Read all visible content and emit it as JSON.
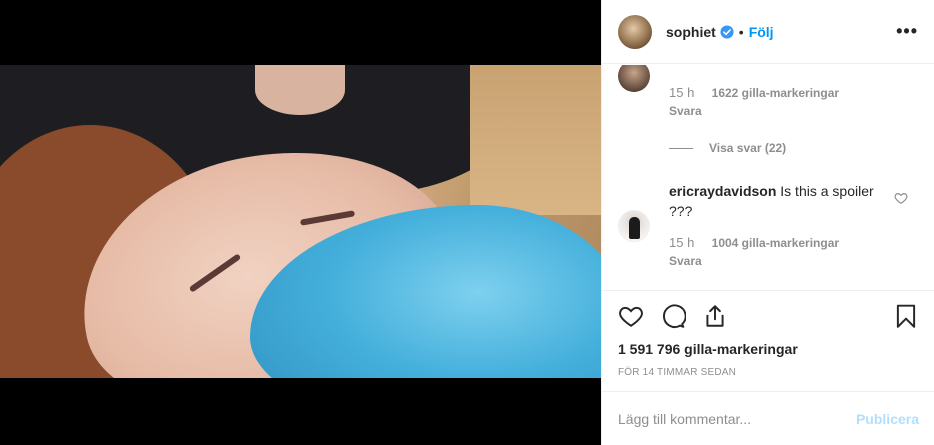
{
  "post": {
    "username": "sophiet",
    "follow_label": "Följ",
    "separator": "•",
    "more_label": "•••",
    "likes": "1 591 796 gilla-markeringar",
    "time_ago": "FÖR 14 TIMMAR SEDAN"
  },
  "comments": {
    "first": {
      "time": "15 h",
      "likes": "1622 gilla-markeringar",
      "reply": "Svara"
    },
    "view_replies": "Visa svar (22)",
    "second": {
      "username": "ericraydavidson",
      "text": "Is this a spoiler ???",
      "time": "15 h",
      "likes": "1004 gilla-markeringar",
      "reply": "Svara"
    }
  },
  "add_comment": {
    "placeholder": "Lägg till kommentar...",
    "publish_label": "Publicera"
  },
  "colors": {
    "accent": "#0095f6",
    "publish_disabled": "#b2dffc",
    "muted": "#8e8e8e"
  },
  "icons": [
    "verified-icon",
    "more-options-icon",
    "heart-icon",
    "comment-icon",
    "share-icon",
    "bookmark-icon"
  ]
}
